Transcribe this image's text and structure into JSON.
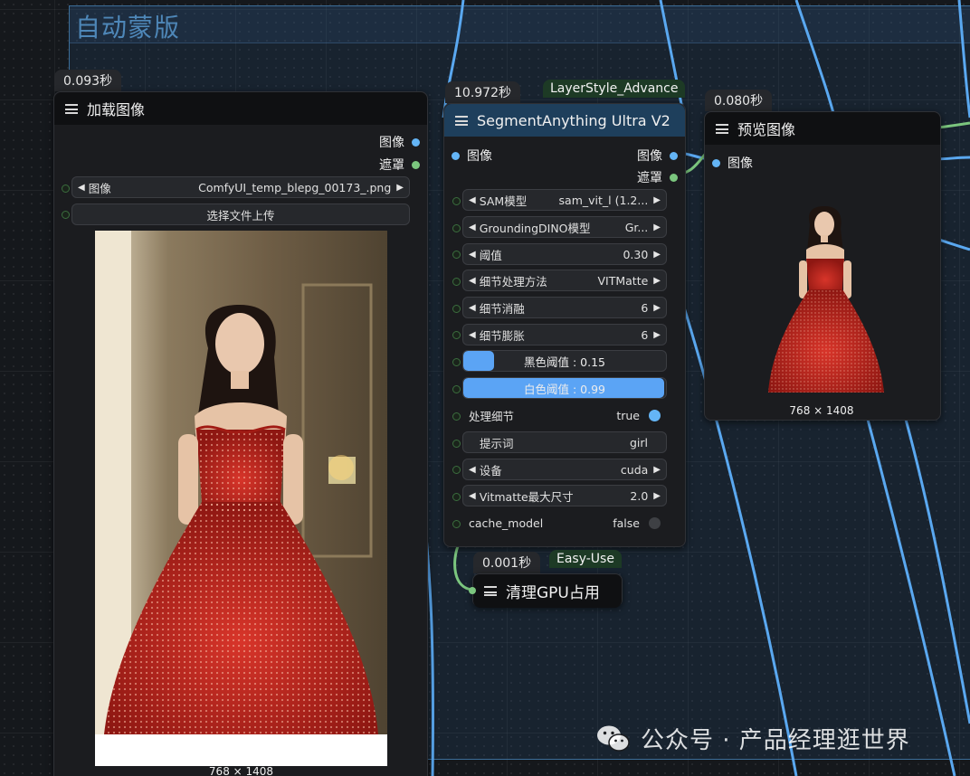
{
  "group": {
    "title": "自动蒙版"
  },
  "load_image": {
    "timing": "0.093秒",
    "title": "加载图像",
    "outputs": [
      "图像",
      "遮罩"
    ],
    "image_label": "图像",
    "image_value": "ComfyUI_temp_blepg_00173_.png",
    "upload_label": "选择文件上传",
    "caption": "768 × 1408"
  },
  "segment": {
    "timing": "10.972秒",
    "badge": "LayerStyle_Advance",
    "title": "SegmentAnything Ultra V2",
    "input": "图像",
    "outputs": [
      "图像",
      "遮罩"
    ],
    "widgets": [
      {
        "label": "SAM模型",
        "value": "sam_vit_l (1.2..."
      },
      {
        "label": "GroundingDINO模型",
        "value": "Gr..."
      },
      {
        "label": "阈值",
        "value": "0.30"
      },
      {
        "label": "细节处理方法",
        "value": "VITMatte"
      },
      {
        "label": "细节消融",
        "value": "6"
      },
      {
        "label": "细节膨胀",
        "value": "6"
      }
    ],
    "black_threshold": {
      "text": "黑色阈值 : 0.15",
      "value": 0.15
    },
    "white_threshold": {
      "text": "白色阈值 : 0.99",
      "value": 0.99
    },
    "detail": {
      "label": "处理细节",
      "value": "true"
    },
    "prompt": {
      "label": "提示词",
      "value": "girl"
    },
    "device": {
      "label": "设备",
      "value": "cuda"
    },
    "vitmatte": {
      "label": "Vitmatte最大尺寸",
      "value": "2.0"
    },
    "cache": {
      "label": "cache_model",
      "value": "false"
    }
  },
  "preview": {
    "timing": "0.080秒",
    "title": "预览图像",
    "input": "图像",
    "caption": "768 × 1408"
  },
  "gpu": {
    "timing": "0.001秒",
    "badge": "Easy-Use",
    "title": "清理GPU占用"
  },
  "watermark": {
    "text": "公众号 · 产品经理逛世界"
  },
  "colors": {
    "image_socket": "#64b5f6",
    "mask_socket": "#7bc67e",
    "slider": "#5ba4f5",
    "badge_bg": "#1d3a25",
    "dress": "#c4261e"
  }
}
